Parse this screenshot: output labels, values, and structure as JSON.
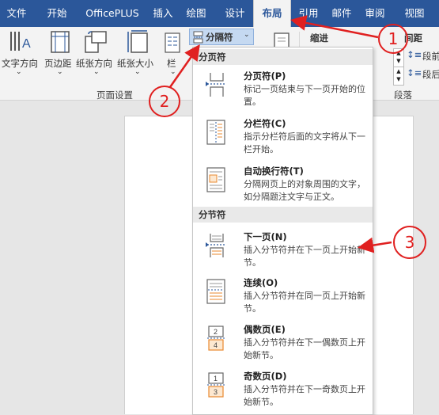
{
  "tabs": [
    "文件",
    "开始",
    "OfficePLUS",
    "插入",
    "绘图",
    "设计",
    "布局",
    "引用",
    "邮件",
    "审阅",
    "视图"
  ],
  "active_tab_index": 6,
  "ribbon": {
    "buttons": [
      "文字方向",
      "页边距",
      "纸张方向",
      "纸张大小",
      "栏"
    ],
    "breaks_button": "分隔符",
    "indent_label": "缩进",
    "spacing_label": "间距",
    "before_label": "段前",
    "after_label": "段后",
    "group_page_setup": "页面设置",
    "group_paragraph": "段落"
  },
  "dropdown": {
    "page_breaks_header": "分页符",
    "section_breaks_header": "分节符",
    "items": [
      {
        "title": "分页符(P)",
        "desc": "标记一页结束与下一页开始的位置。",
        "icon": "page-break-icon"
      },
      {
        "title": "分栏符(C)",
        "desc": "指示分栏符后面的文字将从下一栏开始。",
        "icon": "column-break-icon"
      },
      {
        "title": "自动换行符(T)",
        "desc": "分隔网页上的对象周围的文字，如分隔题注文字与正文。",
        "icon": "text-wrapping-icon"
      },
      {
        "title": "下一页(N)",
        "desc": "插入分节符并在下一页上开始新节。",
        "icon": "next-page-icon"
      },
      {
        "title": "连续(O)",
        "desc": "插入分节符并在同一页上开始新节。",
        "icon": "continuous-icon"
      },
      {
        "title": "偶数页(E)",
        "desc": "插入分节符并在下一偶数页上开始新节。",
        "icon": "even-page-icon"
      },
      {
        "title": "奇数页(D)",
        "desc": "插入分节符并在下一奇数页上开始新节。",
        "icon": "odd-page-icon"
      }
    ]
  },
  "callouts": [
    "1",
    "2",
    "3"
  ],
  "colors": {
    "tabbar": "#2b579a",
    "annotation": "#e02020",
    "accent_orange": "#e8892f"
  }
}
